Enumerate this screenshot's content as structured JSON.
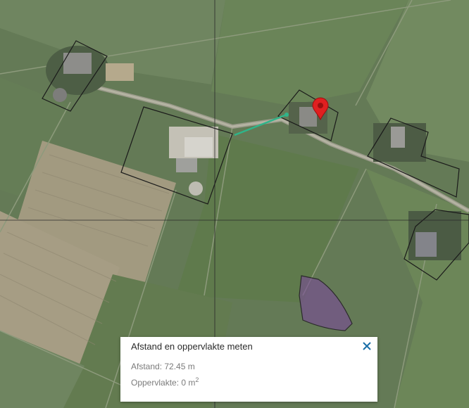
{
  "map": {
    "type": "aerial-photo",
    "marker_icon": "map-pin-icon",
    "measurement_line_color": "#2fb58a",
    "marker_color": "#e02020",
    "highlight_fill": "#7a4a9a"
  },
  "measure_panel": {
    "title": "Afstand en oppervlakte meten",
    "close_icon": "close-icon",
    "distance_label": "Afstand:",
    "distance_value": "72.45 m",
    "area_label": "Oppervlakte:",
    "area_value": "0 m",
    "area_exponent": "2",
    "accent_color": "#1a6fa8"
  }
}
